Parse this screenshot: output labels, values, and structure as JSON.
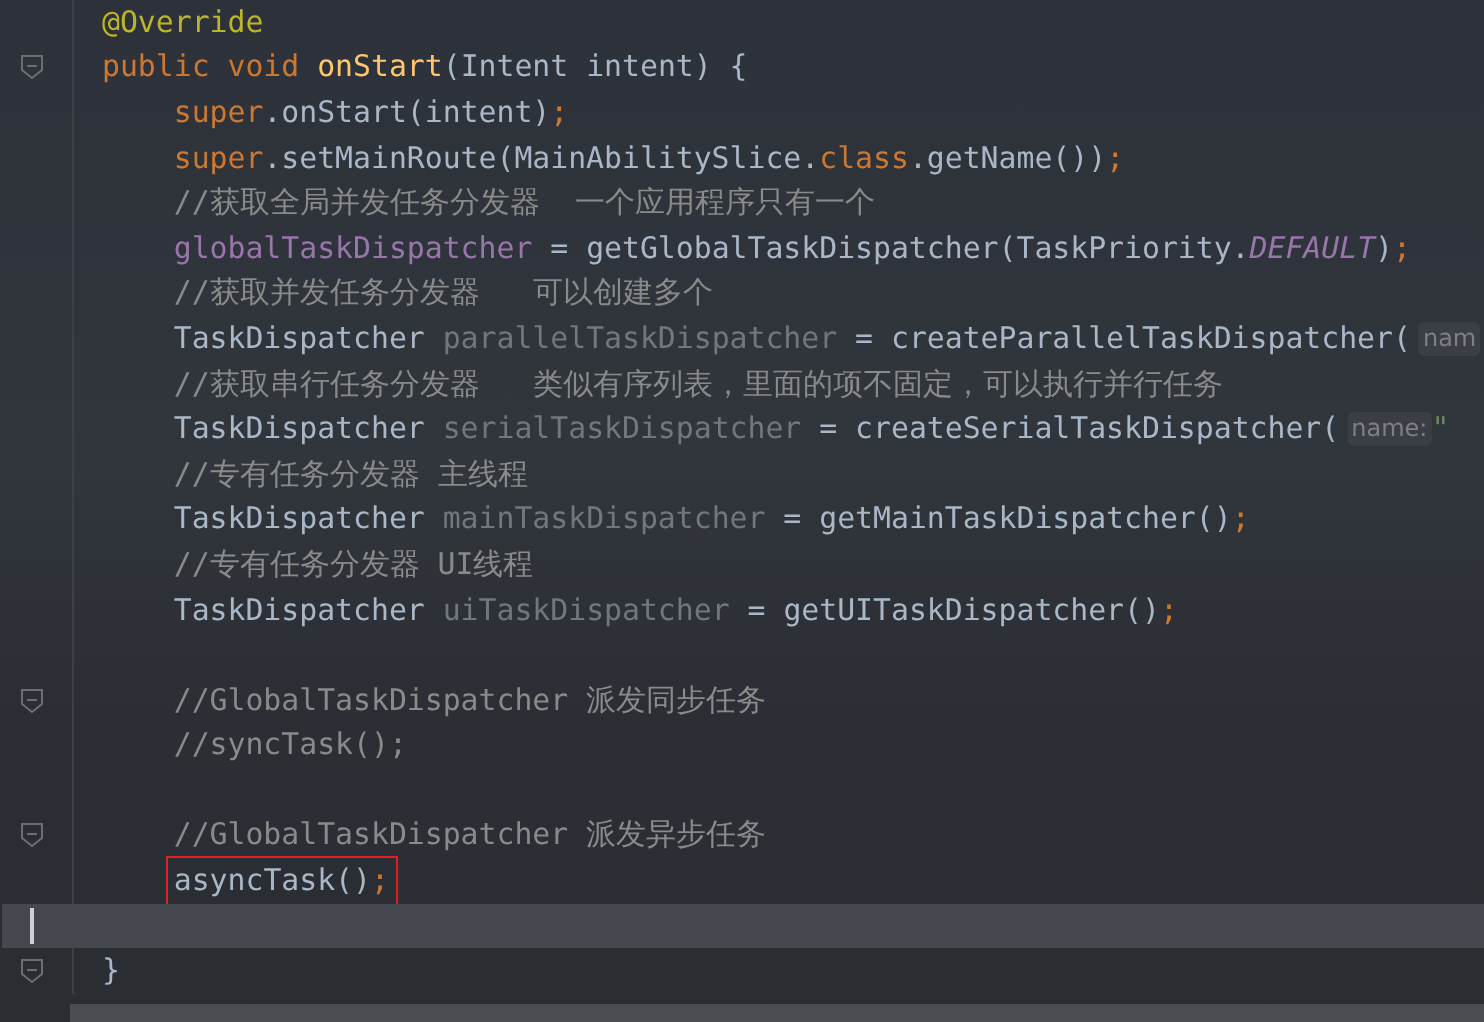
{
  "editor": {
    "lines": [
      {
        "fold": false,
        "current": false,
        "marked": false,
        "tokens": [
          {
            "text": "@Override",
            "kind": "annotation"
          }
        ]
      },
      {
        "fold": true,
        "current": false,
        "marked": false,
        "tokens": [
          {
            "text": "public void ",
            "kind": "keyword"
          },
          {
            "text": "onStart",
            "kind": "method"
          },
          {
            "text": "(Intent intent) {",
            "kind": "plain"
          }
        ]
      },
      {
        "fold": false,
        "current": false,
        "marked": false,
        "tokens": [
          {
            "text": "    super",
            "kind": "keyword"
          },
          {
            "text": ".onStart(intent)",
            "kind": "plain"
          },
          {
            "text": ";",
            "kind": "keyword"
          }
        ]
      },
      {
        "fold": false,
        "current": false,
        "marked": false,
        "tokens": [
          {
            "text": "    super",
            "kind": "keyword"
          },
          {
            "text": ".setMainRoute(MainAbilitySlice.",
            "kind": "plain"
          },
          {
            "text": "class",
            "kind": "keyword"
          },
          {
            "text": ".getName())",
            "kind": "plain"
          },
          {
            "text": ";",
            "kind": "keyword"
          }
        ]
      },
      {
        "fold": false,
        "current": false,
        "marked": false,
        "tokens": [
          {
            "text": "    //获取全局并发任务分发器  一个应用程序只有一个",
            "kind": "comment"
          }
        ]
      },
      {
        "fold": false,
        "current": false,
        "marked": false,
        "tokens": [
          {
            "text": "    globalTaskDispatcher",
            "kind": "field"
          },
          {
            "text": " = getGlobalTaskDispatcher(TaskPriority.",
            "kind": "plain"
          },
          {
            "text": "DEFAULT",
            "kind": "constant"
          },
          {
            "text": ")",
            "kind": "plain"
          },
          {
            "text": ";",
            "kind": "keyword"
          }
        ]
      },
      {
        "fold": false,
        "current": false,
        "marked": false,
        "tokens": [
          {
            "text": "    //获取并发任务分发器   可以创建多个",
            "kind": "comment"
          }
        ]
      },
      {
        "fold": false,
        "current": false,
        "marked": false,
        "tokens": [
          {
            "text": "    TaskDispatcher ",
            "kind": "plain"
          },
          {
            "text": "parallelTaskDispatcher",
            "kind": "unused"
          },
          {
            "text": " = createParallelTaskDispatcher(",
            "kind": "plain"
          }
        ],
        "hint": "nam"
      },
      {
        "fold": false,
        "current": false,
        "marked": false,
        "tokens": [
          {
            "text": "    //获取串行任务分发器   类似有序列表，里面的项不固定，可以执行并行任务",
            "kind": "comment"
          }
        ]
      },
      {
        "fold": false,
        "current": false,
        "marked": false,
        "tokens": [
          {
            "text": "    TaskDispatcher ",
            "kind": "plain"
          },
          {
            "text": "serialTaskDispatcher",
            "kind": "unused"
          },
          {
            "text": " = createSerialTaskDispatcher(",
            "kind": "plain"
          }
        ],
        "hint": "name:",
        "after": "\""
      },
      {
        "fold": false,
        "current": false,
        "marked": false,
        "tokens": [
          {
            "text": "    //专有任务分发器 主线程",
            "kind": "comment"
          }
        ]
      },
      {
        "fold": false,
        "current": false,
        "marked": false,
        "tokens": [
          {
            "text": "    TaskDispatcher ",
            "kind": "plain"
          },
          {
            "text": "mainTaskDispatcher",
            "kind": "unused"
          },
          {
            "text": " = getMainTaskDispatcher()",
            "kind": "plain"
          },
          {
            "text": ";",
            "kind": "keyword"
          }
        ]
      },
      {
        "fold": false,
        "current": false,
        "marked": false,
        "tokens": [
          {
            "text": "    //专有任务分发器 UI线程",
            "kind": "comment"
          }
        ]
      },
      {
        "fold": false,
        "current": false,
        "marked": false,
        "tokens": [
          {
            "text": "    TaskDispatcher ",
            "kind": "plain"
          },
          {
            "text": "uiTaskDispatcher",
            "kind": "unused"
          },
          {
            "text": " = getUITaskDispatcher()",
            "kind": "plain"
          },
          {
            "text": ";",
            "kind": "keyword"
          }
        ]
      },
      {
        "fold": false,
        "current": false,
        "marked": false
      },
      {
        "fold": true,
        "current": false,
        "marked": false,
        "tokens": [
          {
            "text": "    //GlobalTaskDispatcher 派发同步任务",
            "kind": "comment"
          }
        ]
      },
      {
        "fold": false,
        "current": false,
        "marked": false,
        "tokens": [
          {
            "text": "    //syncTask();",
            "kind": "comment"
          }
        ]
      },
      {
        "fold": false,
        "current": false,
        "marked": false
      },
      {
        "fold": true,
        "current": false,
        "marked": false,
        "tokens": [
          {
            "text": "    //GlobalTaskDispatcher 派发异步任务",
            "kind": "comment"
          }
        ]
      },
      {
        "fold": false,
        "current": false,
        "marked": true,
        "tokens": [
          {
            "text": "    asyncTask()",
            "kind": "plain"
          },
          {
            "text": ";",
            "kind": "keyword"
          }
        ]
      },
      {
        "fold": false,
        "current": true,
        "marked": false
      },
      {
        "fold": true,
        "current": false,
        "marked": false,
        "tokens": [
          {
            "text": "}",
            "kind": "plain"
          }
        ]
      }
    ]
  }
}
